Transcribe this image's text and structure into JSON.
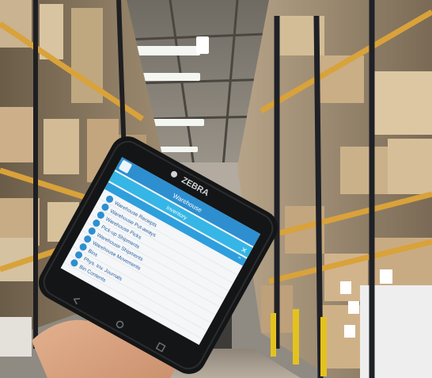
{
  "device": {
    "brand": "ZEBRA"
  },
  "app": {
    "header_title": "Warehouse",
    "menu_header": "Inventory",
    "menu_items": [
      {
        "label": "Warehouse Receipts",
        "icon": "document-icon"
      },
      {
        "label": "Warehouse Put-aways",
        "icon": "box-icon"
      },
      {
        "label": "Warehouse Picks",
        "icon": "box-icon"
      },
      {
        "label": "Pick-up Shipments",
        "icon": "truck-icon"
      },
      {
        "label": "Warehouse Shipments",
        "icon": "truck-icon"
      },
      {
        "label": "Warehouse Movements",
        "icon": "arrows-icon"
      },
      {
        "label": "Bins",
        "icon": "bin-icon"
      },
      {
        "label": "Phys. Inv. Journals",
        "icon": "clipboard-icon"
      },
      {
        "label": "Bin Contents",
        "icon": "grid-icon"
      }
    ]
  },
  "colors": {
    "app_header": "#2d8fd0",
    "menu_header": "#36b6e6",
    "menu_bg": "#f4f6f8",
    "shelf_orange": "#d9a23a"
  }
}
